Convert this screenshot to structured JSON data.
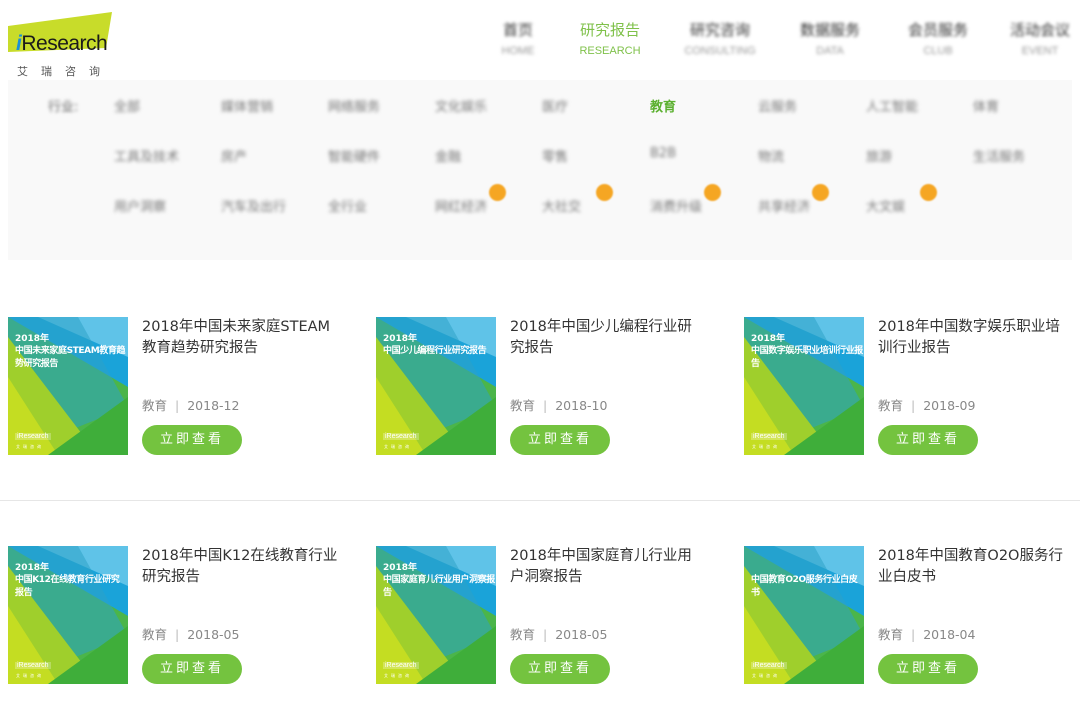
{
  "brand": {
    "logo_text": "Research",
    "logo_prefix": "i",
    "logo_sub": "艾瑞咨询",
    "accent_color": "#7fc14a"
  },
  "nav": [
    {
      "cn": "首页",
      "en": "HOME",
      "active": false
    },
    {
      "cn": "研究报告",
      "en": "RESEARCH",
      "active": true
    },
    {
      "cn": "研究咨询",
      "en": "CONSULTING",
      "active": false
    },
    {
      "cn": "数据服务",
      "en": "DATA",
      "active": false
    },
    {
      "cn": "会员服务",
      "en": "CLUB",
      "active": false
    },
    {
      "cn": "活动会议",
      "en": "EVENT",
      "active": false
    }
  ],
  "filter": {
    "label": "行业:",
    "categories": [
      {
        "label": "全部"
      },
      {
        "label": "媒体营销"
      },
      {
        "label": "网络服务"
      },
      {
        "label": "文化娱乐"
      },
      {
        "label": "医疗"
      },
      {
        "label": "教育",
        "active": true
      },
      {
        "label": "云服务"
      },
      {
        "label": "人工智能"
      },
      {
        "label": "体育"
      },
      {
        "label": "工具及技术"
      },
      {
        "label": "房产"
      },
      {
        "label": "智能硬件"
      },
      {
        "label": "金融"
      },
      {
        "label": "零售"
      },
      {
        "label": "B2B"
      },
      {
        "label": "物流"
      },
      {
        "label": "旅游"
      },
      {
        "label": "生活服务"
      },
      {
        "label": "用户洞察"
      },
      {
        "label": "汽车及出行"
      },
      {
        "label": "全行业"
      },
      {
        "label": "网红经济",
        "hot": true
      },
      {
        "label": "大社交",
        "hot": true
      },
      {
        "label": "消费升级",
        "hot": true
      },
      {
        "label": "共享经济",
        "hot": true
      },
      {
        "label": "大文娱",
        "hot": true
      }
    ]
  },
  "reports": [
    {
      "title": "2018年中国未来家庭STEAM教育趋势研究报告",
      "cover_year": "2018年",
      "cover_title": "中国未来家庭STEAM教育趋势研究报告",
      "category": "教育",
      "date": "2018-12",
      "button": "立即查看"
    },
    {
      "title": "2018年中国少儿编程行业研究报告",
      "cover_year": "2018年",
      "cover_title": "中国少儿编程行业研究报告",
      "category": "教育",
      "date": "2018-10",
      "button": "立即查看"
    },
    {
      "title": "2018年中国数字娱乐职业培训行业报告",
      "cover_year": "2018年",
      "cover_title": "中国数字娱乐职业培训行业报告",
      "category": "教育",
      "date": "2018-09",
      "button": "立即查看"
    },
    {
      "title": "2018年中国K12在线教育行业研究报告",
      "cover_year": "2018年",
      "cover_title": "中国K12在线教育行业研究报告",
      "category": "教育",
      "date": "2018-05",
      "button": "立即查看"
    },
    {
      "title": "2018年中国家庭育儿行业用户洞察报告",
      "cover_year": "2018年",
      "cover_title": "中国家庭育儿行业用户洞察报告",
      "category": "教育",
      "date": "2018-05",
      "button": "立即查看"
    },
    {
      "title": "2018年中国教育O2O服务行业白皮书",
      "cover_year": "",
      "cover_title": "中国教育O2O服务行业白皮书",
      "category": "教育",
      "date": "2018-04",
      "button": "立即查看"
    }
  ],
  "cover_logo": "iResearch",
  "cover_logo_sub": "艾瑞咨询"
}
